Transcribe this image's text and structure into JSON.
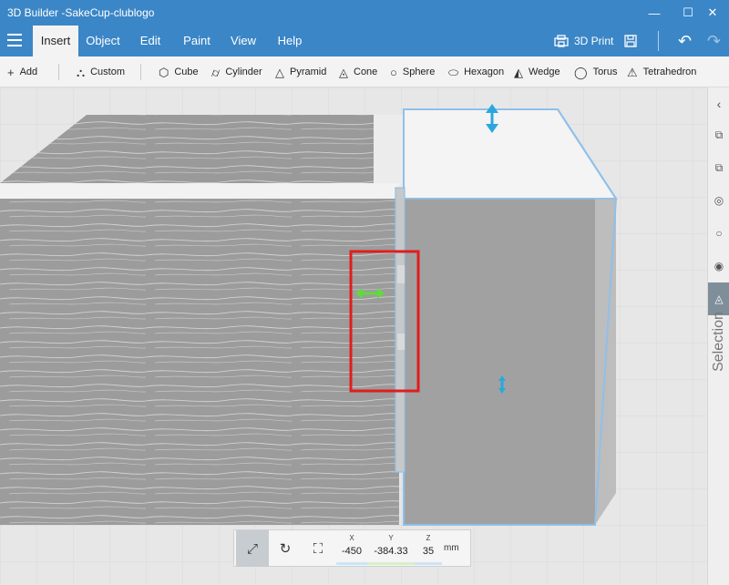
{
  "window": {
    "title": "3D Builder -SakeCup-clublogo",
    "minimize": "—",
    "maximize": "☐",
    "close": "✕"
  },
  "tabs": [
    {
      "label": "Insert",
      "active": true
    },
    {
      "label": "Object"
    },
    {
      "label": "Edit"
    },
    {
      "label": "Paint"
    },
    {
      "label": "View"
    },
    {
      "label": "Help"
    }
  ],
  "ribbon_right": {
    "print_label": "3D Print",
    "print_icon": "printer-icon",
    "save_icon": "save-icon",
    "undo_icon": "undo-icon",
    "redo_icon": "redo-icon"
  },
  "toolbar": {
    "add": "Add",
    "custom": "Custom",
    "shapes": [
      "Cube",
      "Cylinder",
      "Pyramid",
      "Cone",
      "Sphere",
      "Hexagon",
      "Wedge",
      "Torus",
      "Tetrahedron"
    ]
  },
  "right_panel": {
    "label": "Selection"
  },
  "transform": {
    "x_label": "X",
    "x_value": "-450",
    "y_label": "Y",
    "y_value": "-384.33",
    "z_label": "Z",
    "z_value": "35",
    "unit": "mm",
    "colors": {
      "x": "#c9e6f7",
      "y": "#d5f0c8",
      "z": "#cfe3f5"
    }
  },
  "colors": {
    "accent": "#3b86c7",
    "highlight_box": "#e11d1d",
    "selection_outline": "#8fc0ea"
  }
}
